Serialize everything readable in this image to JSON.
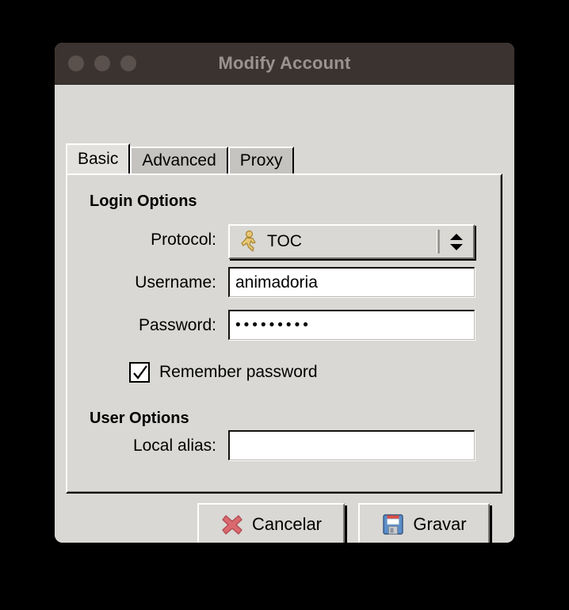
{
  "window": {
    "title": "Modify Account",
    "traffic_lights": [
      "close-button",
      "minimize-button",
      "zoom-button"
    ],
    "titlebar_color": "#3b332f",
    "titlebar_text_color": "#9b938e",
    "background_color": "#d9d8d4"
  },
  "tabs": [
    {
      "label": "Basic",
      "active": true
    },
    {
      "label": "Advanced",
      "active": false
    },
    {
      "label": "Proxy",
      "active": false
    }
  ],
  "basic_tab": {
    "login_options": {
      "title": "Login Options",
      "protocol": {
        "label": "Protocol:",
        "value": "TOC",
        "icon": "aim-running-man-icon",
        "icon_color": "#d9b25a"
      },
      "username": {
        "label": "Username:",
        "value": "animadoria",
        "placeholder": ""
      },
      "password": {
        "label": "Password:",
        "value": "•••••••••",
        "masked_length": 9,
        "placeholder": ""
      },
      "remember_password": {
        "label": "Remember password",
        "checked": true
      }
    },
    "user_options": {
      "title": "User Options",
      "local_alias": {
        "label": "Local alias:",
        "value": "",
        "placeholder": ""
      }
    }
  },
  "buttons": {
    "cancel": {
      "label": "Cancelar",
      "icon": "red-x-icon",
      "icon_color": "#d4656a"
    },
    "save": {
      "label": "Gravar",
      "icon": "floppy-disk-save-icon",
      "icon_color": "#4a7fc1"
    }
  }
}
